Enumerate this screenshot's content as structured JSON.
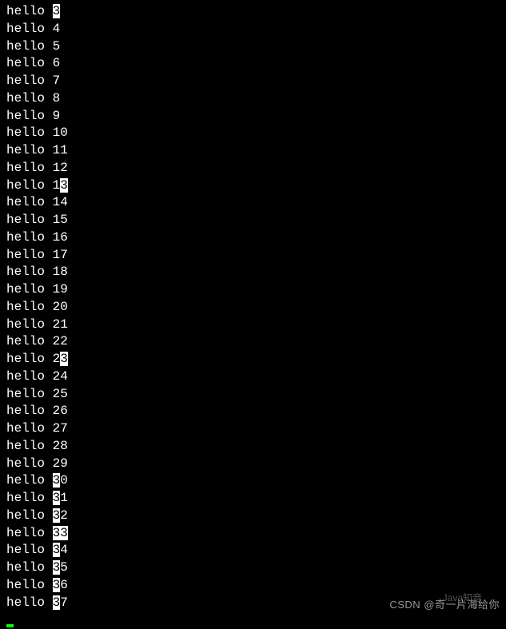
{
  "terminal": {
    "prefix": "hello ",
    "lines": [
      {
        "before": "",
        "hl": "3",
        "after": ""
      },
      {
        "before": "4",
        "hl": "",
        "after": ""
      },
      {
        "before": "5",
        "hl": "",
        "after": ""
      },
      {
        "before": "6",
        "hl": "",
        "after": ""
      },
      {
        "before": "7",
        "hl": "",
        "after": ""
      },
      {
        "before": "8",
        "hl": "",
        "after": ""
      },
      {
        "before": "9",
        "hl": "",
        "after": ""
      },
      {
        "before": "10",
        "hl": "",
        "after": ""
      },
      {
        "before": "11",
        "hl": "",
        "after": ""
      },
      {
        "before": "12",
        "hl": "",
        "after": ""
      },
      {
        "before": "1",
        "hl": "3",
        "after": ""
      },
      {
        "before": "14",
        "hl": "",
        "after": ""
      },
      {
        "before": "15",
        "hl": "",
        "after": ""
      },
      {
        "before": "16",
        "hl": "",
        "after": ""
      },
      {
        "before": "17",
        "hl": "",
        "after": ""
      },
      {
        "before": "18",
        "hl": "",
        "after": ""
      },
      {
        "before": "19",
        "hl": "",
        "after": ""
      },
      {
        "before": "20",
        "hl": "",
        "after": ""
      },
      {
        "before": "21",
        "hl": "",
        "after": ""
      },
      {
        "before": "22",
        "hl": "",
        "after": ""
      },
      {
        "before": "2",
        "hl": "3",
        "after": ""
      },
      {
        "before": "24",
        "hl": "",
        "after": ""
      },
      {
        "before": "25",
        "hl": "",
        "after": ""
      },
      {
        "before": "26",
        "hl": "",
        "after": ""
      },
      {
        "before": "27",
        "hl": "",
        "after": ""
      },
      {
        "before": "28",
        "hl": "",
        "after": ""
      },
      {
        "before": "29",
        "hl": "",
        "after": ""
      },
      {
        "before": "",
        "hl": "3",
        "after": "0"
      },
      {
        "before": "",
        "hl": "3",
        "after": "1"
      },
      {
        "before": "",
        "hl": "3",
        "after": "2"
      },
      {
        "before": "",
        "hl": "33",
        "after": ""
      },
      {
        "before": "",
        "hl": "3",
        "after": "4"
      },
      {
        "before": "",
        "hl": "3",
        "after": "5"
      },
      {
        "before": "",
        "hl": "3",
        "after": "6"
      },
      {
        "before": "",
        "hl": "3",
        "after": "7"
      }
    ]
  },
  "watermark": {
    "text": "CSDN @奇一片海给你",
    "sub": "Java知音"
  }
}
